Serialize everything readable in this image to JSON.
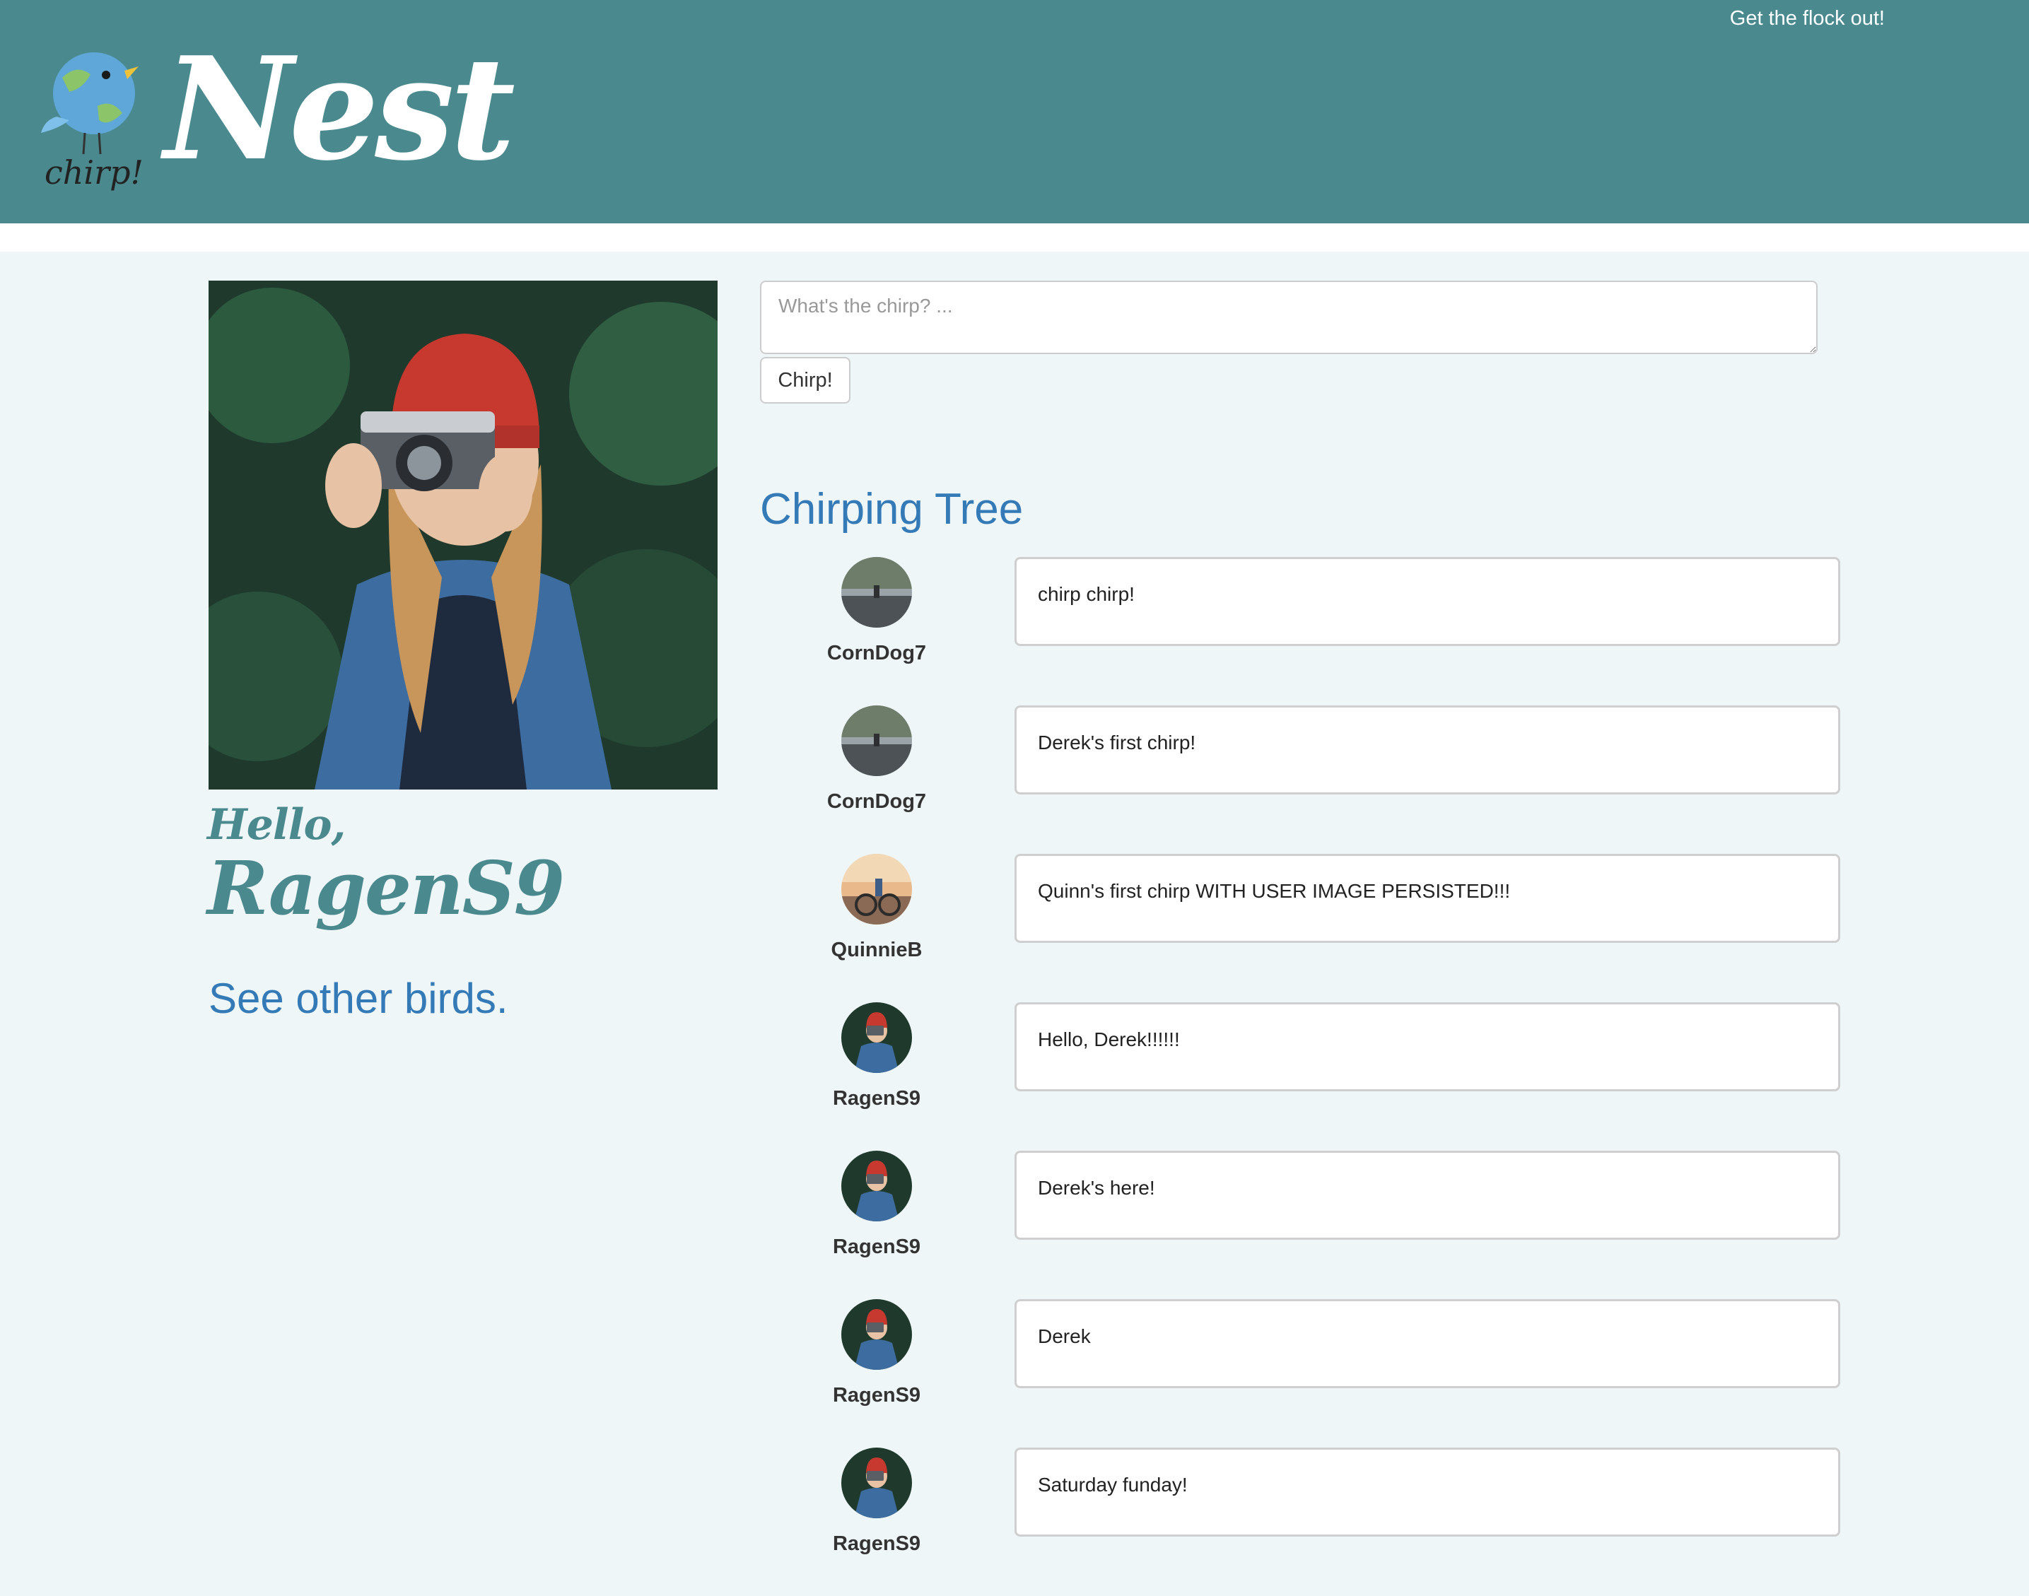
{
  "header": {
    "logo_text": "chirp!",
    "brand": "Nest",
    "logout_label": "Get the flock out!"
  },
  "profile": {
    "greeting": "Hello,",
    "username": "RagenS9",
    "see_others_label": "See other birds."
  },
  "compose": {
    "placeholder": "What's the chirp? ...",
    "submit_label": "Chirp!"
  },
  "feed": {
    "title": "Chirping Tree",
    "chirps": [
      {
        "user": "CornDog7",
        "text": "chirp chirp!",
        "avatar": "road-photo"
      },
      {
        "user": "CornDog7",
        "text": "Derek's first chirp!",
        "avatar": "road-photo"
      },
      {
        "user": "QuinnieB",
        "text": "Quinn's first chirp WITH USER IMAGE PERSISTED!!!",
        "avatar": "bike-photo"
      },
      {
        "user": "RagenS9",
        "text": "Hello, Derek!!!!!!",
        "avatar": "camera-girl-photo"
      },
      {
        "user": "RagenS9",
        "text": "Derek's here!",
        "avatar": "camera-girl-photo"
      },
      {
        "user": "RagenS9",
        "text": "Derek",
        "avatar": "camera-girl-photo"
      },
      {
        "user": "RagenS9",
        "text": "Saturday funday!",
        "avatar": "camera-girl-photo"
      }
    ]
  },
  "colors": {
    "header_bg": "#4a8a8e",
    "page_bg": "#eff6f8",
    "link": "#337ab7",
    "accent_text": "#4a8a8e"
  }
}
